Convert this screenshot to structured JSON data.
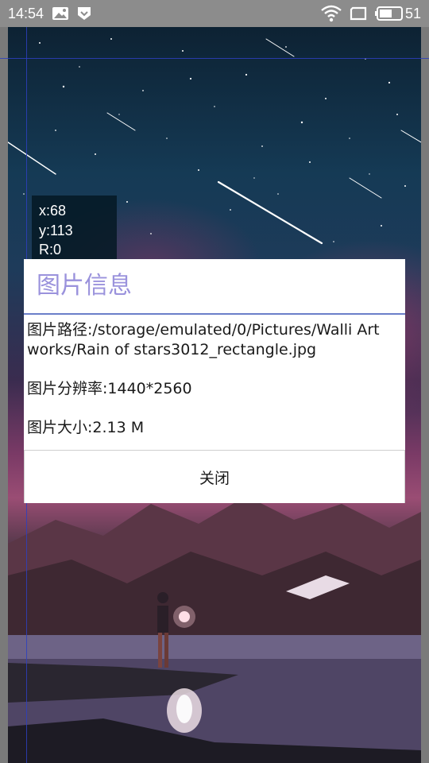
{
  "status_bar": {
    "time": "14:54",
    "icons": [
      "photo-icon",
      "shield-icon",
      "wifi-icon",
      "screen-icon",
      "battery-icon"
    ],
    "battery_level": "51"
  },
  "overlay": {
    "x_label": "x:68",
    "y_label": "y:113",
    "r_label": "R:0"
  },
  "dialog": {
    "title": "图片信息",
    "path": "图片路径:/storage/emulated/0/Pictures/Walli Artworks/Rain of stars3012_rectangle.jpg",
    "resolution": "图片分辨率:1440*2560",
    "size": "图片大小:2.13 M",
    "close_label": "关闭"
  },
  "colors": {
    "title": "#9a92dc",
    "divider": "#6b7fc9",
    "guide": "#2d3fbf"
  }
}
